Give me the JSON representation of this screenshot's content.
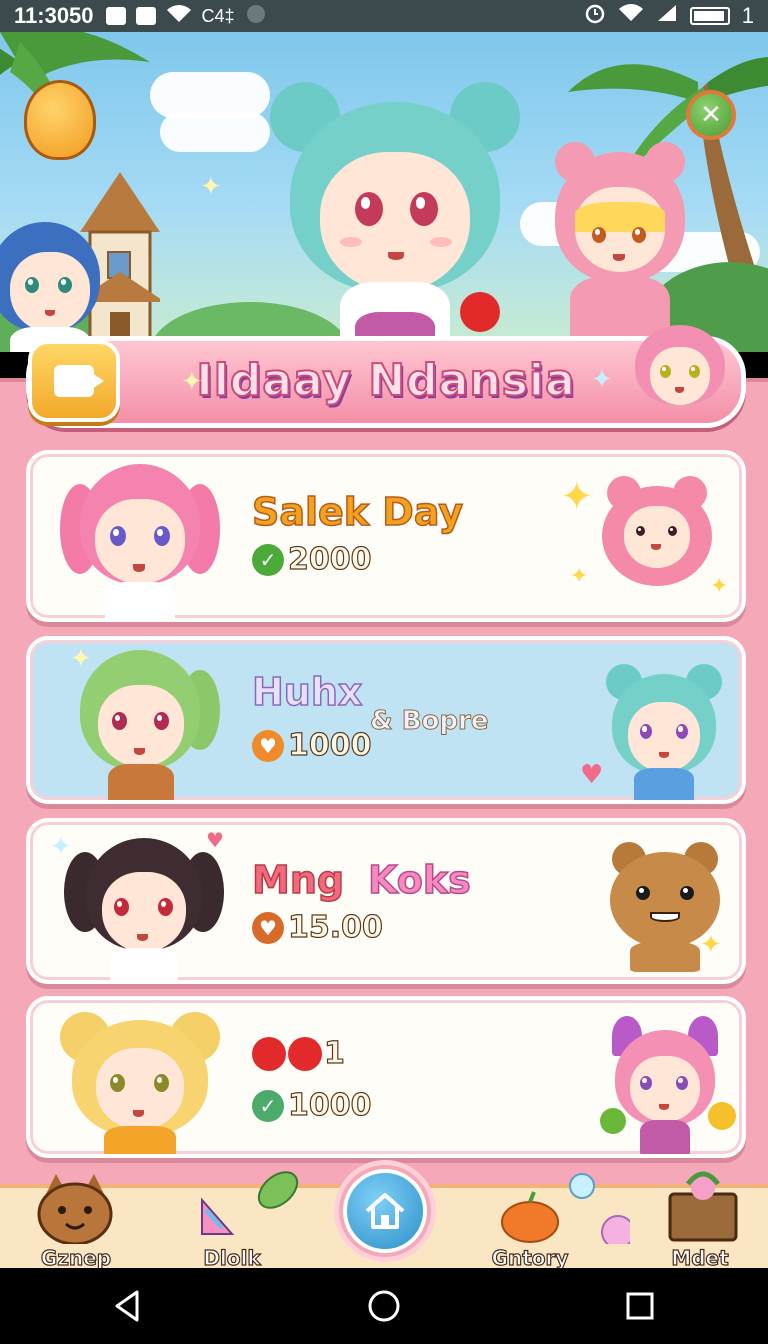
{
  "status_bar": {
    "time": "11:3050",
    "carrier": "C4‡",
    "battery_label": "1"
  },
  "banner": {
    "title": "Ildaay Ndansia"
  },
  "cards": [
    {
      "title": "Salek Day",
      "subtitle": "",
      "price": "2000",
      "price_icon": "check-coin-icon",
      "title_color": "#f0a41c",
      "bg": "#fffdf8"
    },
    {
      "title": "Huhx",
      "subtitle": "& Bopre",
      "price": "1000",
      "price_icon": "heart-coin-icon",
      "title_color": "#c9b2f0",
      "bg": "#bfe3f2"
    },
    {
      "title": "Mng",
      "title2": "Koks",
      "subtitle": "",
      "price": "15.00",
      "price_icon": "heart-coin-icon",
      "title_color": "#f06a7a",
      "bg": "#fffdf8"
    },
    {
      "title": "",
      "count": "1",
      "subtitle": "",
      "price": "1000",
      "price_icon": "check-coin-icon",
      "title_color": "#e84a4a",
      "bg": "#fffdf8"
    }
  ],
  "bottom_nav": {
    "items": [
      {
        "label": "Gznep",
        "icon": "cat-icon"
      },
      {
        "label": "Dlolk",
        "icon": "party-hat-icon"
      },
      {
        "label": "Gntory",
        "icon": "fruit-icon"
      },
      {
        "label": "Mdet",
        "icon": "treasure-chest-icon"
      }
    ],
    "home_icon": "home-icon"
  },
  "colors": {
    "panel": "#f5a8b8",
    "banner": "#f48fa8",
    "accent_blue": "#2b8fc8",
    "gold": "#f2a92a"
  }
}
